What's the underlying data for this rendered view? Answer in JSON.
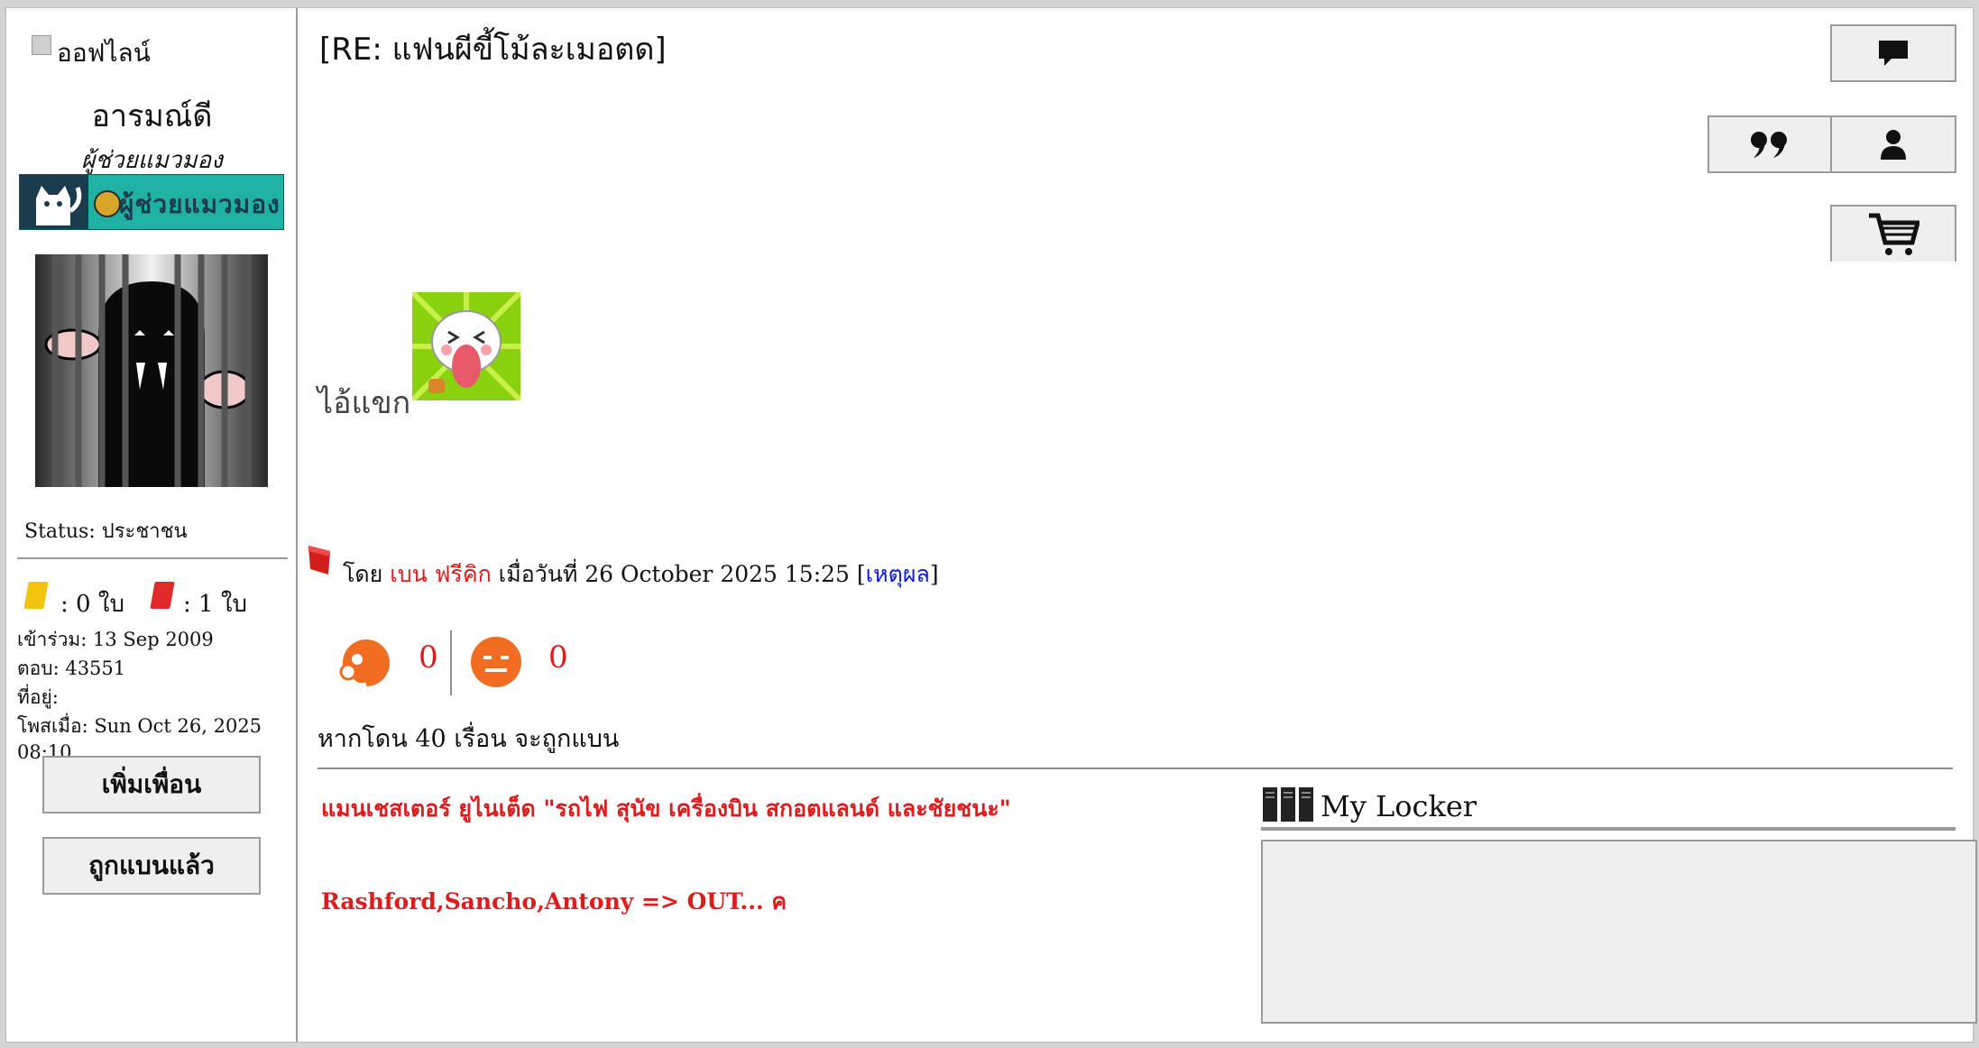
{
  "user": {
    "online_status": "ออฟไลน์",
    "username": "อารมณ์ดี",
    "rank": "ผู้ช่วยแมวมอง",
    "rank_badge_text": "ผู้ช่วยแมวมอง",
    "signal": "Status: ประชาชน",
    "yellow_cards": ": 0 ใบ",
    "red_cards": ": 1 ใบ",
    "joined": "เข้าร่วม: 13 Sep 2009",
    "replies": "ตอบ: 43551",
    "location": "ที่อยู่:",
    "posted_at": "โพสเมื่อ: Sun Oct 26, 2025 08:10",
    "add_friend_label": "เพิ่มเพื่อน",
    "banned_label": "ถูกแบนแล้ว",
    "colors": {
      "yellow_card": "#f2c40f",
      "red_card": "#e02b2b",
      "badge_teal": "#1fb1a4"
    }
  },
  "post": {
    "title": "[RE: แฟนผีขี้โม้ละเมอตด]",
    "body_text": "ไอ้แขก",
    "ban": {
      "prefix": "โดย",
      "moderator": "เบน ฟรีคิก",
      "date_text": "เมื่อวันที่ 26 October 2025 15:25 [",
      "reason_link": "เหตุผล",
      "suffix": "]"
    },
    "votes": {
      "like": "0",
      "dislike": "0"
    },
    "ban_note": "หากโดน 40 เรื่อน จะถูกแบน",
    "signature": [
      "แมนเชสเตอร์ ยูไนเต็ด \"รถไฟ สุนัข เครื่องบิน สกอตแลนด์ และชัยชนะ\"",
      "Rashford,Sancho,Antony => OUT... ค"
    ]
  },
  "toolbar": {
    "icons": [
      "comment-icon",
      "quote-icon",
      "profile-icon",
      "cart-icon"
    ]
  },
  "locker": {
    "title": "My Locker"
  }
}
